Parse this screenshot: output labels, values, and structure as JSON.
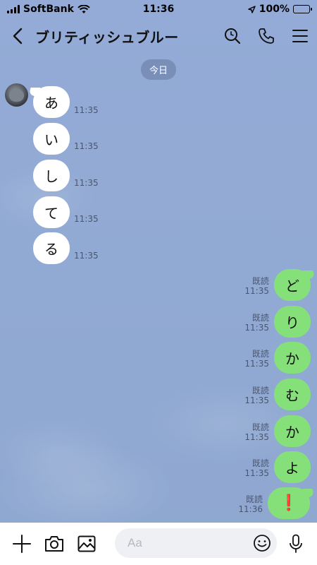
{
  "status_bar": {
    "carrier": "SoftBank",
    "time": "11:36",
    "battery": "100%"
  },
  "header": {
    "back_icon": "chevron-left-icon",
    "title": "ブリティッシュブルー",
    "search_icon": "search-icon",
    "call_icon": "phone-icon",
    "menu_icon": "menu-icon"
  },
  "chat": {
    "date_label": "今日",
    "incoming": [
      {
        "text": "あ",
        "time": "11:35"
      },
      {
        "text": "い",
        "time": "11:35"
      },
      {
        "text": "し",
        "time": "11:35"
      },
      {
        "text": "て",
        "time": "11:35"
      },
      {
        "text": "る",
        "time": "11:35"
      }
    ],
    "outgoing": [
      {
        "text": "ど",
        "read": "既読",
        "time": "11:35"
      },
      {
        "text": "り",
        "read": "既読",
        "time": "11:35"
      },
      {
        "text": "か",
        "read": "既読",
        "time": "11:35"
      },
      {
        "text": "む",
        "read": "既読",
        "time": "11:35"
      },
      {
        "text": "か",
        "read": "既読",
        "time": "11:35"
      },
      {
        "text": "よ",
        "read": "既読",
        "time": "11:35"
      },
      {
        "text": "❗",
        "read": "既読",
        "time": "11:36"
      }
    ]
  },
  "composer": {
    "placeholder": "Aa",
    "plus_icon": "plus-icon",
    "camera_icon": "camera-icon",
    "image_icon": "image-icon",
    "emoji_icon": "emoji-icon",
    "mic_icon": "microphone-icon"
  },
  "colors": {
    "background": "#8fa8d0",
    "outgoing_bubble": "#85e07a",
    "incoming_bubble": "#ffffff"
  }
}
